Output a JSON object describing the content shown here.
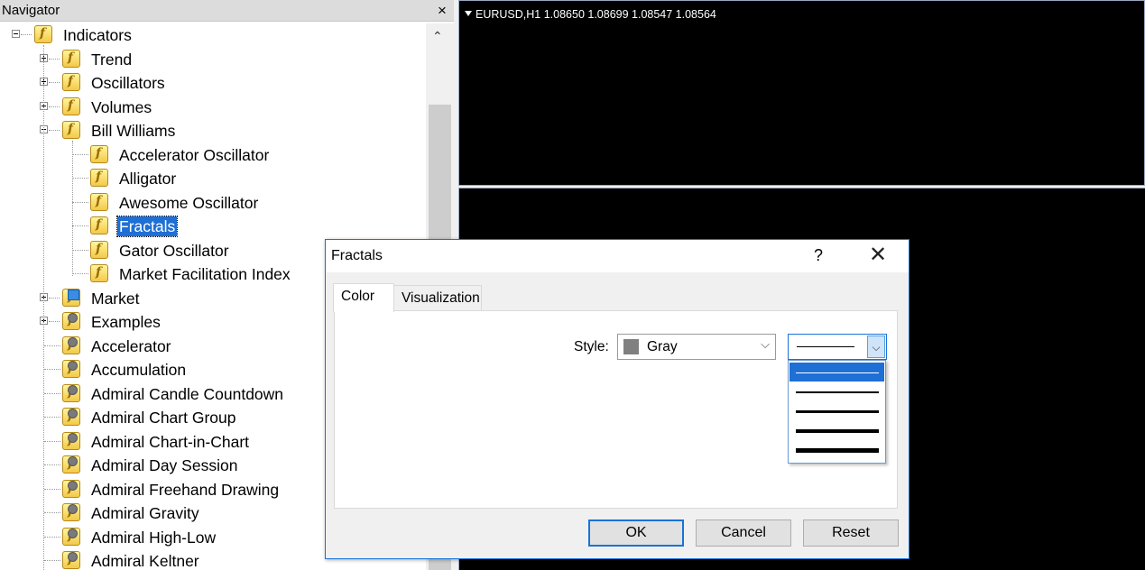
{
  "navigator": {
    "title": "Navigator",
    "close": "×",
    "scroll_up": "⌃",
    "items": [
      {
        "label": "Indicators",
        "level": 0,
        "expander": "minus",
        "icon": "indicator-folder-icon",
        "selected": false
      },
      {
        "label": "Trend",
        "level": 1,
        "expander": "plus",
        "icon": "indicator-folder-icon",
        "selected": false
      },
      {
        "label": "Oscillators",
        "level": 1,
        "expander": "plus",
        "icon": "indicator-folder-icon",
        "selected": false
      },
      {
        "label": "Volumes",
        "level": 1,
        "expander": "plus",
        "icon": "indicator-folder-icon",
        "selected": false
      },
      {
        "label": "Bill Williams",
        "level": 1,
        "expander": "minus",
        "icon": "indicator-folder-icon",
        "selected": false
      },
      {
        "label": "Accelerator Oscillator",
        "level": 2,
        "expander": "",
        "icon": "indicator-icon",
        "selected": false
      },
      {
        "label": "Alligator",
        "level": 2,
        "expander": "",
        "icon": "indicator-icon",
        "selected": false
      },
      {
        "label": "Awesome Oscillator",
        "level": 2,
        "expander": "",
        "icon": "indicator-icon",
        "selected": false
      },
      {
        "label": "Fractals",
        "level": 2,
        "expander": "",
        "icon": "indicator-icon",
        "selected": true
      },
      {
        "label": "Gator Oscillator",
        "level": 2,
        "expander": "",
        "icon": "indicator-icon",
        "selected": false
      },
      {
        "label": "Market Facilitation Index",
        "level": 2,
        "expander": "",
        "icon": "indicator-icon",
        "selected": false
      },
      {
        "label": "Market",
        "level": 1,
        "expander": "plus",
        "icon": "market-indicator-icon",
        "selected": false
      },
      {
        "label": "Examples",
        "level": 1,
        "expander": "plus",
        "icon": "custom-indicator-icon",
        "selected": false
      },
      {
        "label": "Accelerator",
        "level": 1,
        "expander": "",
        "icon": "custom-indicator-icon",
        "selected": false
      },
      {
        "label": "Accumulation",
        "level": 1,
        "expander": "",
        "icon": "custom-indicator-icon",
        "selected": false
      },
      {
        "label": "Admiral Candle Countdown",
        "level": 1,
        "expander": "",
        "icon": "custom-indicator-icon",
        "selected": false
      },
      {
        "label": "Admiral Chart Group",
        "level": 1,
        "expander": "",
        "icon": "custom-indicator-icon",
        "selected": false
      },
      {
        "label": "Admiral Chart-in-Chart",
        "level": 1,
        "expander": "",
        "icon": "custom-indicator-icon",
        "selected": false
      },
      {
        "label": "Admiral Day Session",
        "level": 1,
        "expander": "",
        "icon": "custom-indicator-icon",
        "selected": false
      },
      {
        "label": "Admiral Freehand Drawing",
        "level": 1,
        "expander": "",
        "icon": "custom-indicator-icon",
        "selected": false
      },
      {
        "label": "Admiral Gravity",
        "level": 1,
        "expander": "",
        "icon": "custom-indicator-icon",
        "selected": false
      },
      {
        "label": "Admiral High-Low",
        "level": 1,
        "expander": "",
        "icon": "custom-indicator-icon",
        "selected": false
      },
      {
        "label": "Admiral Keltner",
        "level": 1,
        "expander": "",
        "icon": "custom-indicator-icon",
        "selected": false
      }
    ]
  },
  "chart": {
    "info": "EURUSD,H1  1.08650 1.08699 1.08547 1.08564",
    "background": "#000000"
  },
  "dialog": {
    "title": "Fractals",
    "help": "?",
    "close": "✕",
    "tabs": [
      {
        "label": "Color",
        "active": true
      },
      {
        "label": "Visualization",
        "active": false
      }
    ],
    "style_label": "Style:",
    "color_select": {
      "value": "Gray",
      "swatch": "#808080",
      "arrow": "⌵"
    },
    "width_select": {
      "arrow": "⌵",
      "options": [
        1,
        2,
        3,
        4,
        5
      ],
      "selected_index": 0
    },
    "buttons": {
      "ok": "OK",
      "cancel": "Cancel",
      "reset": "Reset"
    },
    "accent": "#1a73d9"
  }
}
